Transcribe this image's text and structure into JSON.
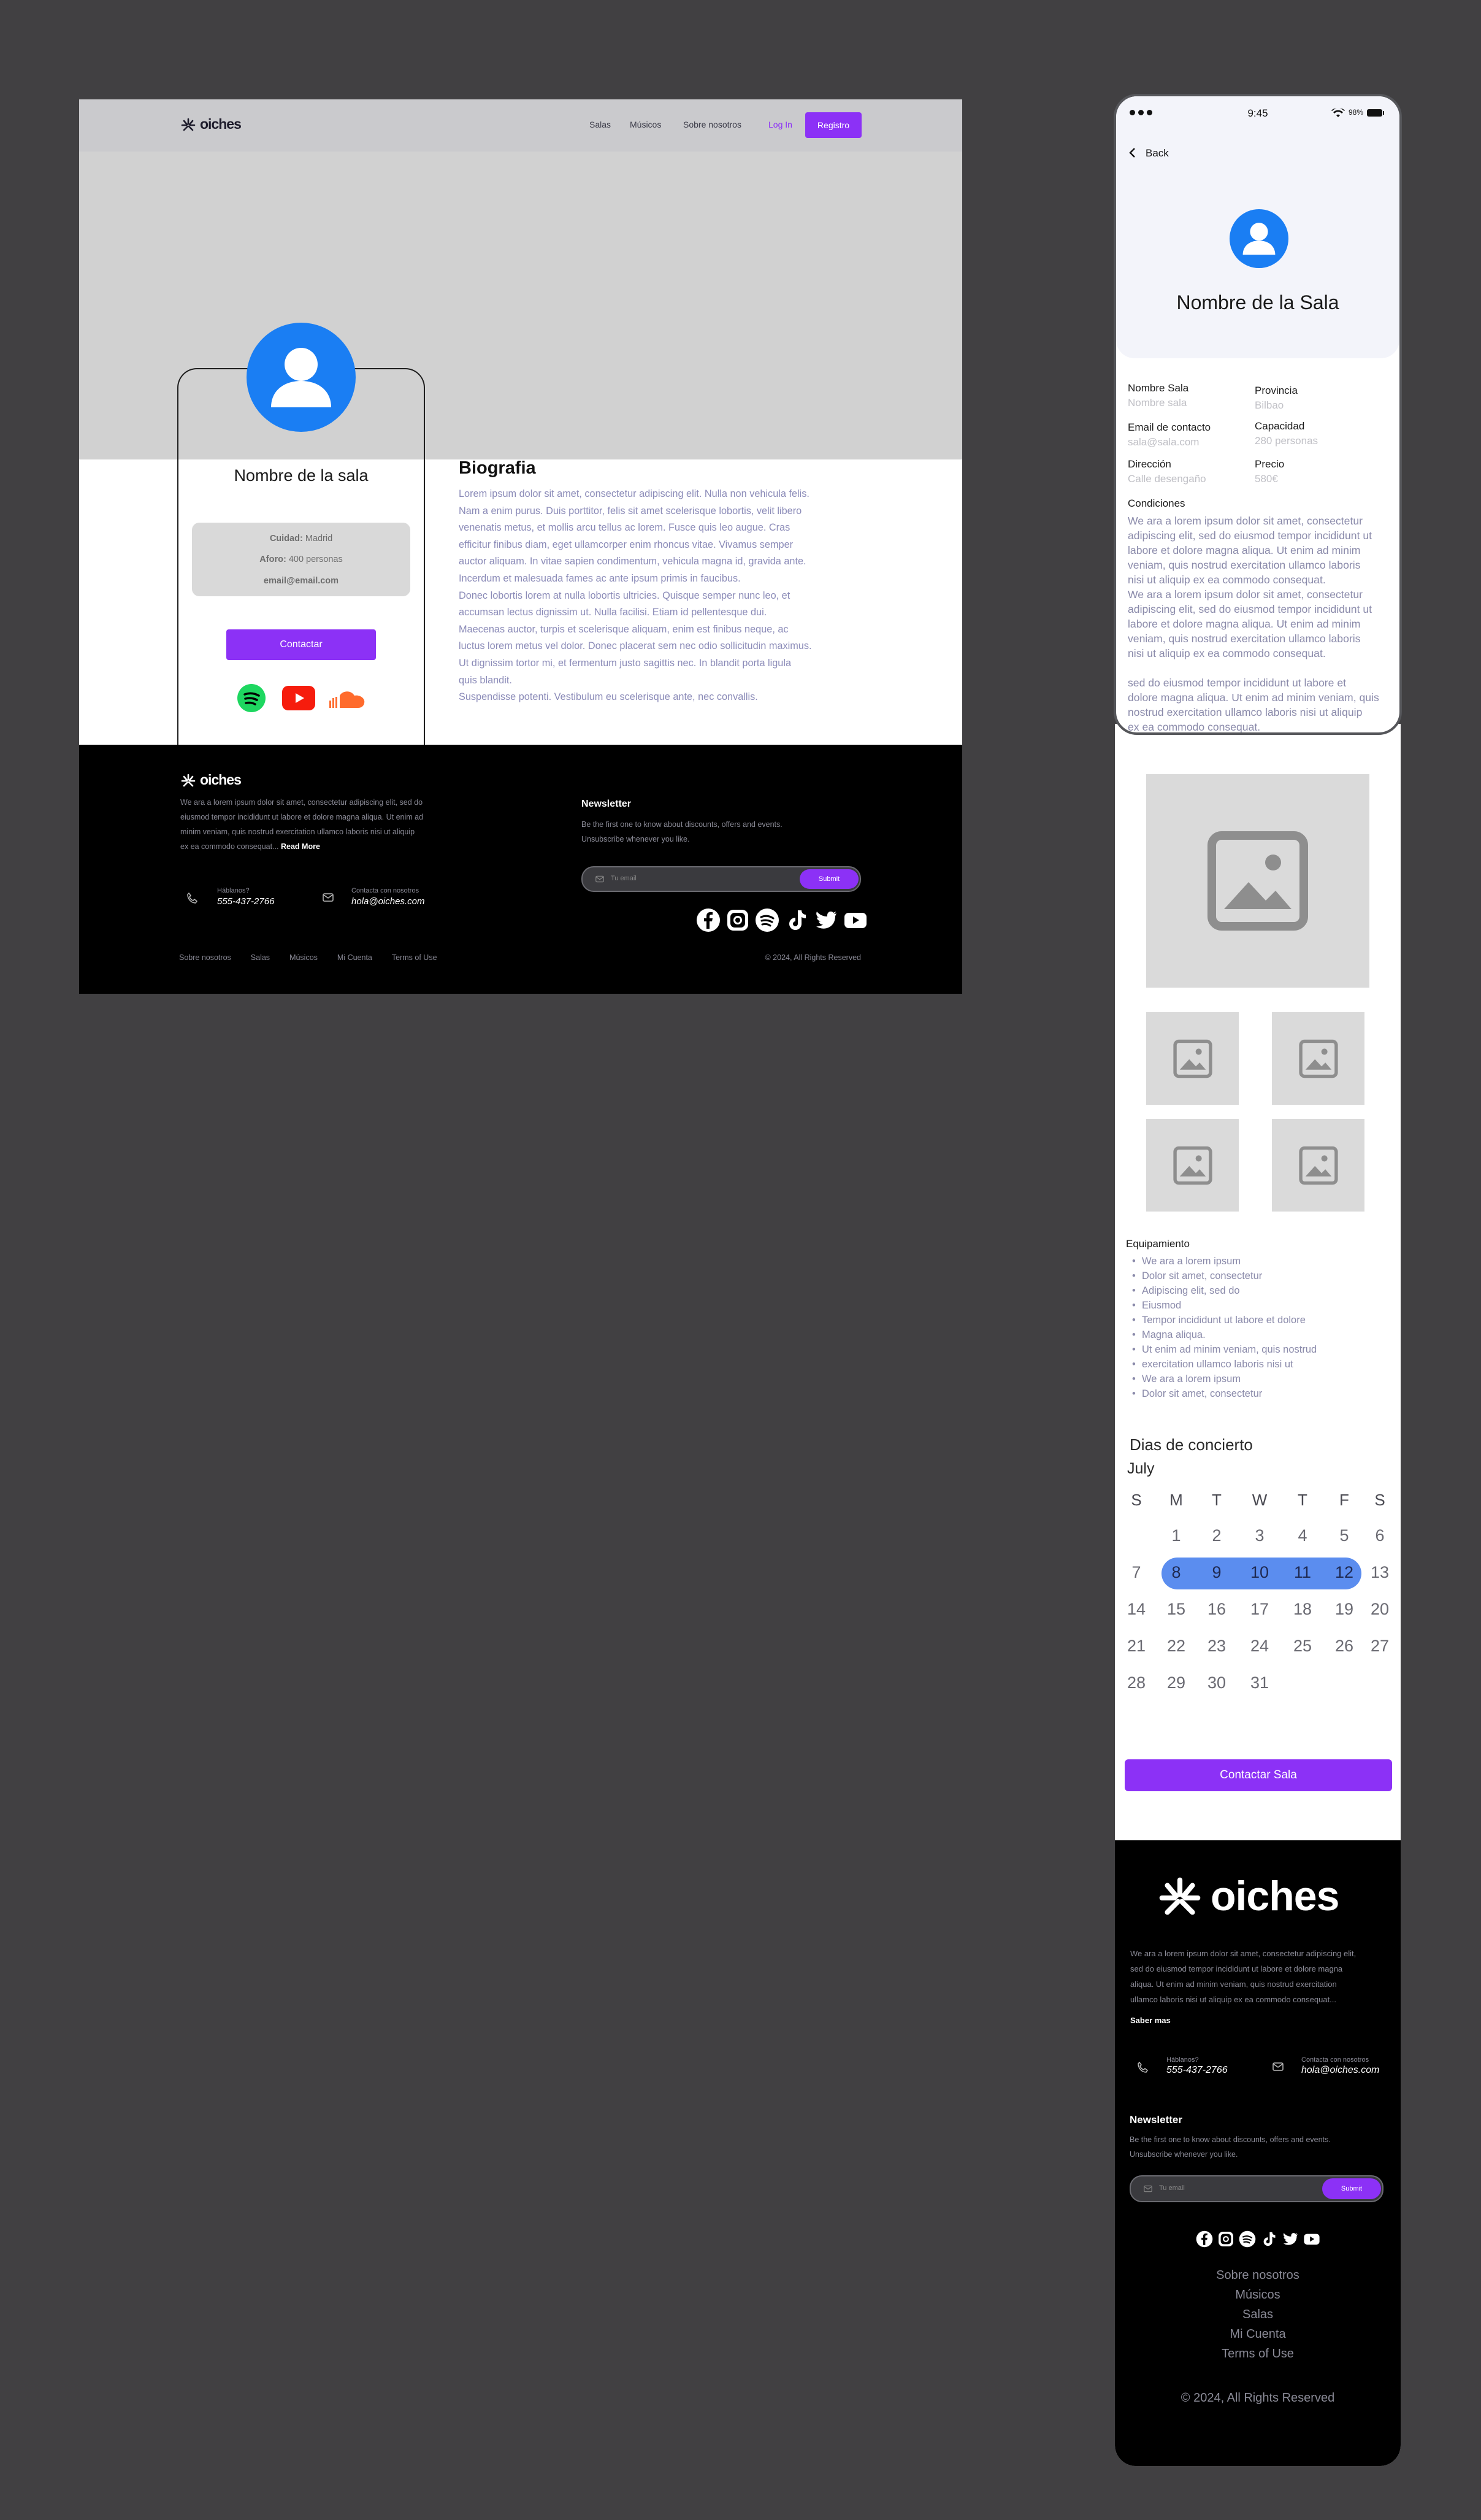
{
  "brand": {
    "name": "oiches"
  },
  "desktop": {
    "nav": {
      "items": [
        "Salas",
        "Músicos",
        "Sobre nosotros"
      ],
      "login": "Log In",
      "register": "Registro"
    },
    "card": {
      "name": "Nombre de la sala",
      "city_label": "Cuidad:",
      "city_value": "Madrid",
      "capacity_label": "Aforo:",
      "capacity_value": "400 personas",
      "email": "email@email.com",
      "contact": "Contactar"
    },
    "bio": {
      "title": "Biografia",
      "lines": [
        "Lorem ipsum dolor sit amet, consectetur adipiscing elit. Nulla non vehicula felis.",
        "Nam a enim purus. Duis porttitor, felis sit amet scelerisque lobortis, velit libero",
        "venenatis metus, et mollis arcu tellus ac lorem. Fusce quis leo augue. Cras",
        "efficitur finibus diam, eget ullamcorper enim rhoncus vitae. Vivamus semper",
        "auctor aliquam. In vitae sapien condimentum, vehicula magna id, gravida ante.",
        "Incerdum et malesuada fames ac ante ipsum primis in faucibus.",
        "Donec lobortis lorem at nulla lobortis ultricies. Quisque semper nunc leo, et",
        "accumsan lectus dignissim ut. Nulla facilisi. Etiam id pellentesque dui.",
        "Maecenas auctor, turpis et scelerisque aliquam, enim est finibus neque, ac",
        "luctus lorem metus vel dolor. Donec placerat sem nec odio sollicitudin maximus.",
        "Ut dignissim tortor mi, et fermentum justo sagittis nec. In blandit porta ligula",
        "quis blandit.",
        "Suspendisse potenti. Vestibulum eu scelerisque ante, nec convallis."
      ]
    },
    "footer": {
      "desc_lines": [
        "We ara a lorem ipsum dolor sit amet, consectetur adipiscing elit, sed do",
        "eiusmod tempor incididunt ut labore et dolore magna aliqua. Ut enim ad",
        "minim veniam, quis nostrud exercitation ullamco laboris nisi ut aliquip",
        "ex ea commodo consequat..."
      ],
      "read_more": "Read More",
      "phone_label": "Háblanos?",
      "phone": "555-437-2766",
      "email_label": "Contacta con nosotros",
      "email": "hola@oiches.com",
      "newsletter_title": "Newsletter",
      "newsletter_lines": [
        "Be the first one to know  about discounts, offers and events.",
        "Unsubscribe whenever you like."
      ],
      "email_placeholder": "Tu email",
      "submit": "Submit",
      "links": [
        "Sobre nosotros",
        "Salas",
        "Músicos",
        "Mi Cuenta",
        "Terms of Use"
      ],
      "copyright": "© 2024, All Rights Reserved"
    }
  },
  "mobile": {
    "status": {
      "time": "9:45",
      "battery": "98%"
    },
    "back": "Back",
    "title": "Nombre de la Sala",
    "fields": {
      "name_label": "Nombre Sala",
      "name_value": "Nombre sala",
      "province_label": "Provincia",
      "province_value": "Bilbao",
      "email_label": "Email de contacto",
      "email_value": "sala@sala.com",
      "capacity_label": "Capacidad",
      "capacity_value": "280 personas",
      "address_label": "Dirección",
      "address_value": "Calle desengaño",
      "price_label": "Precio",
      "price_value": "580€"
    },
    "conditions_title": "Condiciones",
    "conditions_lines": [
      "We ara a lorem ipsum dolor sit amet, consectetur",
      "adipiscing elit, sed do eiusmod tempor incididunt ut",
      "labore et dolore magna aliqua. Ut enim ad minim",
      "veniam, quis nostrud exercitation ullamco laboris",
      "nisi ut aliquip ex ea commodo consequat.",
      "We ara a lorem ipsum dolor sit amet, consectetur",
      "adipiscing elit, sed do eiusmod tempor incididunt ut",
      "labore et dolore magna aliqua. Ut enim ad minim",
      "veniam, quis nostrud exercitation ullamco laboris",
      "nisi ut aliquip ex ea commodo consequat.",
      "",
      "sed do eiusmod tempor incididunt ut labore et",
      "dolore magna aliqua. Ut enim ad minim veniam, quis",
      "nostrud exercitation ullamco laboris nisi ut aliquip",
      "ex ea commodo consequat."
    ],
    "equipment_title": "Equipamiento",
    "equipment": [
      "We ara a lorem ipsum",
      "Dolor sit amet, consectetur",
      "Adipiscing elit, sed do",
      "Eiusmod",
      "Tempor incididunt ut labore et dolore",
      "Magna aliqua.",
      "Ut enim ad minim veniam, quis nostrud",
      "exercitation ullamco laboris nisi ut",
      "We ara a lorem ipsum",
      "Dolor sit amet, consectetur"
    ],
    "calendar": {
      "title": "Dias de concierto",
      "month": "July",
      "weekdays": [
        "S",
        "M",
        "T",
        "W",
        "T",
        "F",
        "S"
      ],
      "weeks": [
        [
          "",
          "1",
          "2",
          "3",
          "4",
          "5",
          "6"
        ],
        [
          "7",
          "8",
          "9",
          "10",
          "11",
          "12",
          "13"
        ],
        [
          "14",
          "15",
          "16",
          "17",
          "18",
          "19",
          "20"
        ],
        [
          "21",
          "22",
          "23",
          "24",
          "25",
          "26",
          "27"
        ],
        [
          "28",
          "29",
          "30",
          "31",
          "",
          "",
          ""
        ]
      ],
      "selected_range": [
        "8",
        "12"
      ]
    },
    "contact_button": "Contactar Sala",
    "footer": {
      "desc_lines": [
        "We ara a lorem ipsum dolor sit amet, consectetur adipiscing elit,",
        "sed do eiusmod tempor incididunt ut labore et dolore magna",
        "aliqua. Ut enim ad minim veniam, quis nostrud exercitation",
        "ullamco laboris nisi ut aliquip ex ea commodo consequat..."
      ],
      "read_more": "Saber mas",
      "phone_label": "Háblanos?",
      "phone": "555-437-2766",
      "email_label": "Contacta con nosotros",
      "email": "hola@oiches.com",
      "newsletter_title": "Newsletter",
      "newsletter_lines": [
        "Be the first one to know  about discounts, offers and events.",
        "Unsubscribe whenever you like."
      ],
      "email_placeholder": "Tu email",
      "submit": "Submit",
      "links": [
        "Sobre nosotros",
        "Músicos",
        "Salas",
        "Mi Cuenta",
        "Terms of Use"
      ],
      "copyright": "© 2024, All Rights Reserved"
    }
  },
  "colors": {
    "accent": "#8c31f6",
    "avatar": "#1a7ef3",
    "calendar_selected": "#5b8def"
  },
  "icons": [
    "oiches-logo-icon",
    "user-icon",
    "spotify-icon",
    "youtube-icon",
    "soundcloud-icon",
    "phone-icon",
    "mail-icon",
    "facebook-icon",
    "instagram-icon",
    "tiktok-icon",
    "twitter-icon",
    "chevron-left-icon",
    "image-icon",
    "wifi-icon",
    "battery-icon"
  ]
}
